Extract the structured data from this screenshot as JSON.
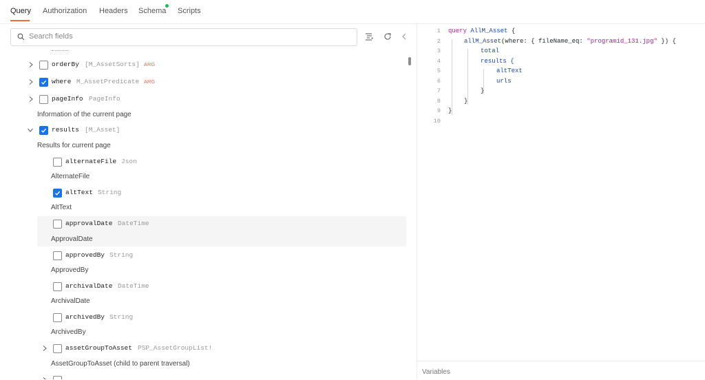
{
  "tabs": [
    {
      "label": "Query",
      "active": true
    },
    {
      "label": "Authorization"
    },
    {
      "label": "Headers"
    },
    {
      "label": "Schema",
      "indicator": true
    },
    {
      "label": "Scripts"
    }
  ],
  "search": {
    "placeholder": "Search fields",
    "value": ""
  },
  "fields": [
    {
      "name": "orderBy",
      "type": "[M_AssetSorts]",
      "arg": "ARG",
      "checked": false,
      "expandable": true,
      "expanded": false
    },
    {
      "name": "where",
      "type": "M_AssetPredicate",
      "arg": "ARG",
      "checked": true,
      "expandable": true,
      "expanded": false
    },
    {
      "name": "pageInfo",
      "type": "PageInfo",
      "checked": false,
      "expandable": true,
      "expanded": false,
      "description": "Information of the current page"
    },
    {
      "name": "results",
      "type": "[M_Asset]",
      "checked": true,
      "expandable": true,
      "expanded": true,
      "description": "Results for current page",
      "children": [
        {
          "name": "alternateFile",
          "type": "Json",
          "checked": false,
          "description": "AlternateFile"
        },
        {
          "name": "altText",
          "type": "String",
          "checked": true,
          "description": "AltText"
        },
        {
          "name": "approvalDate",
          "type": "DateTime",
          "checked": false,
          "description": "ApprovalDate",
          "hovered": true
        },
        {
          "name": "approvedBy",
          "type": "String",
          "checked": false,
          "description": "ApprovedBy"
        },
        {
          "name": "archivalDate",
          "type": "DateTime",
          "checked": false,
          "description": "ArchivalDate"
        },
        {
          "name": "archivedBy",
          "type": "String",
          "checked": false,
          "description": "ArchivedBy"
        },
        {
          "name": "assetGroupToAsset",
          "type": "PSP_AssetGroupList!",
          "checked": false,
          "expandable": true,
          "description": "AssetGroupToAsset (child to parent traversal)"
        }
      ]
    }
  ],
  "editor": {
    "line_numbers": [
      "1",
      "2",
      "3",
      "4",
      "5",
      "6",
      "7",
      "8",
      "9",
      "10"
    ],
    "line1": {
      "kw": "query",
      "name": "AllM_Asset",
      "brace": "{"
    },
    "line2": {
      "field": "allM_Asset",
      "open": "(where: { fileName_eq: ",
      "str": "\"programid_131.jpg\"",
      "close": " }) {"
    },
    "line3": "total",
    "line4": "results {",
    "line5": "altText",
    "line6": "urls",
    "line7": "}",
    "line8": "}",
    "line9": "}"
  },
  "variables_label": "Variables",
  "colors": {
    "accent": "#f26b3a",
    "checkbox": "#1a73e8",
    "arg": "#e2705a",
    "indicator": "#1eb854"
  }
}
